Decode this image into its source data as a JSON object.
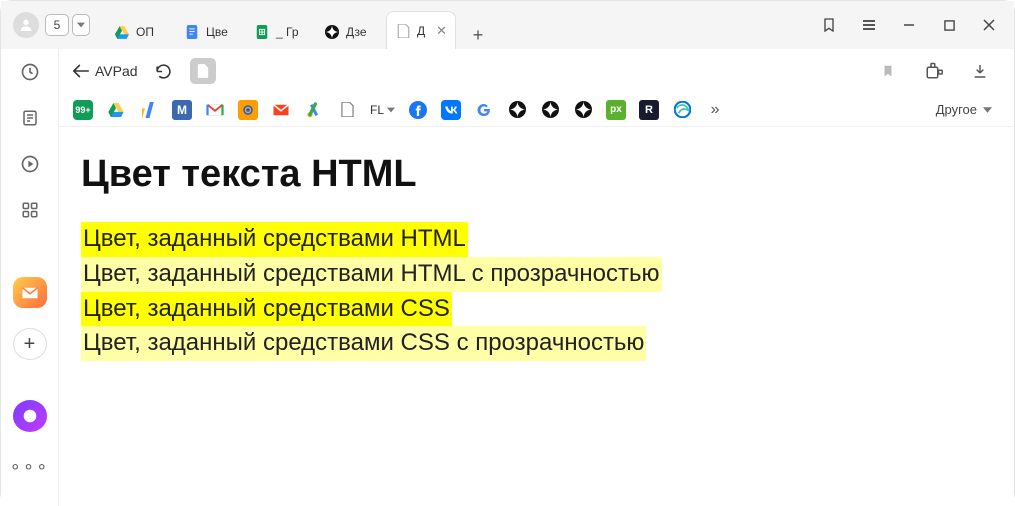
{
  "window": {
    "tab_count": "5"
  },
  "tabs": [
    {
      "label": "ОП"
    },
    {
      "label": "Цве"
    },
    {
      "label": "_ Гр"
    },
    {
      "label": "Дзе"
    },
    {
      "label": "Д"
    }
  ],
  "addressbar": {
    "back_label": "AVPad"
  },
  "bookmarks": {
    "fl_label": "FL",
    "other_label": "Другое"
  },
  "page": {
    "title": "Цвет текста HTML",
    "lines": [
      {
        "text": "Цвет, заданный средствами HTML",
        "bg": "yellow"
      },
      {
        "text": "Цвет, заданный средствами HTML с прозрачностью",
        "bg": "yellow-trans"
      },
      {
        "text": "Цвет, заданный средствами CSS",
        "bg": "yellow"
      },
      {
        "text": "Цвет, заданный средствами CSS с прозрачностью",
        "bg": "yellow-trans"
      }
    ]
  }
}
